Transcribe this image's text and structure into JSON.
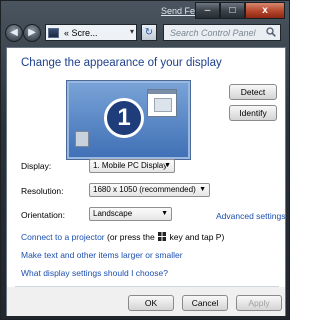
{
  "titlebar": {
    "send_feedback": "Send Feedback",
    "minimize": "–",
    "maximize": "□",
    "close": "x"
  },
  "nav": {
    "back_glyph": "◀",
    "forward_glyph": "▶",
    "address_text": "« Scre...",
    "address_dropdown": "▾",
    "refresh_glyph": "↻",
    "search_placeholder": "Search Control Panel"
  },
  "main": {
    "title": "Change the appearance of your display",
    "monitor_number": "1",
    "detect_label": "Detect",
    "identify_label": "Identify",
    "display_label": "Display:",
    "display_value": "1. Mobile PC Display",
    "resolution_label": "Resolution:",
    "resolution_value": "1680 x 1050 (recommended)",
    "orientation_label": "Orientation:",
    "orientation_value": "Landscape",
    "advanced_link": "Advanced settings",
    "projector_link": "Connect to a projector",
    "projector_suffix": "(or press the",
    "projector_suffix2": "key and tap P)",
    "text_size_link": "Make text and other items larger or smaller",
    "choose_link": "What display settings should I choose?"
  },
  "footer": {
    "ok": "OK",
    "cancel": "Cancel",
    "apply": "Apply"
  },
  "colors": {
    "link": "#1c4fb0",
    "title": "#1e3f8f",
    "monitor": "#3f6fb5"
  }
}
